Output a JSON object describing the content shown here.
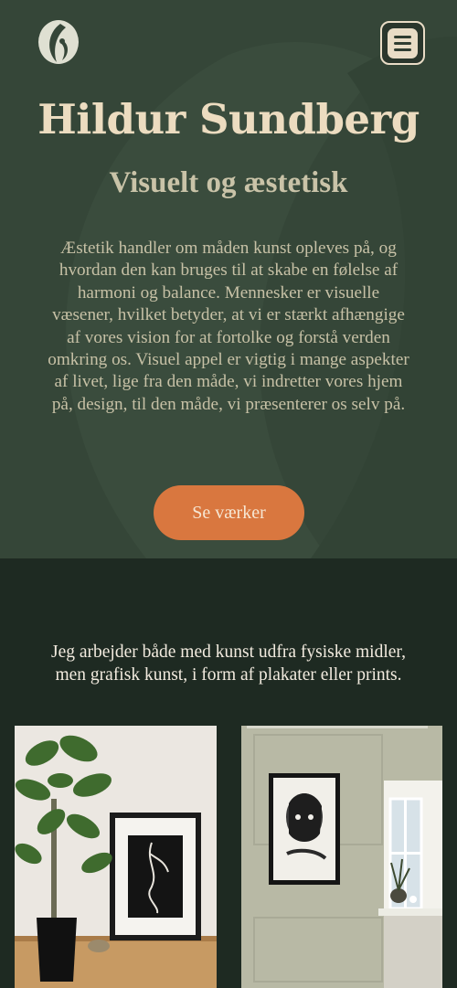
{
  "header": {
    "logo_icon": "leaf-monogram-icon",
    "menu_icon": "hamburger-menu-icon"
  },
  "hero": {
    "title": "Hildur Sundberg",
    "subtitle": "Visuelt og æstetisk",
    "intro": "Æstetik handler om måden kunst opleves på, og hvordan den kan bruges til at skabe en følelse af harmoni og balance. Mennesker er visuelle væsener, hvilket betyder, at vi er stærkt afhængige af vores vision for at fortolke og forstå verden omkring os. Visuel appel er vigtig i mange aspekter af livet, lige fra den måde, vi indretter vores hjem på, design, til den måde, vi præsenterer os selv på.",
    "cta_label": "Se værker"
  },
  "works": {
    "text": "Jeg arbejder både med kunst udfra fysiske midler, men grafisk kunst, i form af plakater eller prints."
  },
  "colors": {
    "hero_bg": "#354638",
    "page_bg": "#1e2a22",
    "accent": "#d9773f",
    "cream": "#ecdcc0"
  }
}
